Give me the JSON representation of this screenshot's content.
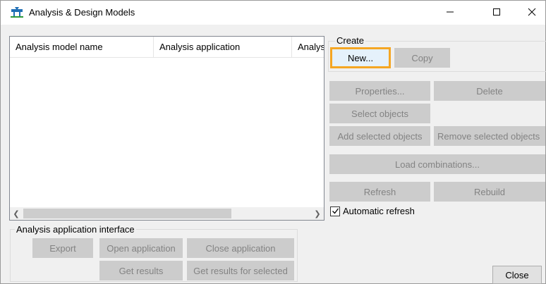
{
  "window": {
    "title": "Analysis & Design Models",
    "app_icon": "tekla-model-icon",
    "controls": [
      "minimize-icon",
      "maximize-icon",
      "close-icon"
    ]
  },
  "list": {
    "columns": [
      "Analysis model name",
      "Analysis application",
      "Analys"
    ],
    "rows": []
  },
  "create_group": {
    "label": "Create",
    "new_label": "New...",
    "copy_label": "Copy"
  },
  "actions": {
    "properties_label": "Properties...",
    "delete_label": "Delete",
    "select_objects_label": "Select objects",
    "add_selected_label": "Add selected objects",
    "remove_selected_label": "Remove selected objects",
    "load_combinations_label": "Load combinations...",
    "refresh_label": "Refresh",
    "rebuild_label": "Rebuild"
  },
  "auto_refresh": {
    "label": "Automatic refresh",
    "checked": true
  },
  "interface_group": {
    "label": "Analysis application interface",
    "export_label": "Export",
    "open_app_label": "Open application",
    "close_app_label": "Close application",
    "get_results_label": "Get results",
    "get_results_selected_label": "Get results for selected"
  },
  "footer": {
    "close_label": "Close"
  },
  "colors": {
    "focus_outline": "#f5a623",
    "disabled_button": "#cccccc",
    "disabled_text": "#838383"
  }
}
